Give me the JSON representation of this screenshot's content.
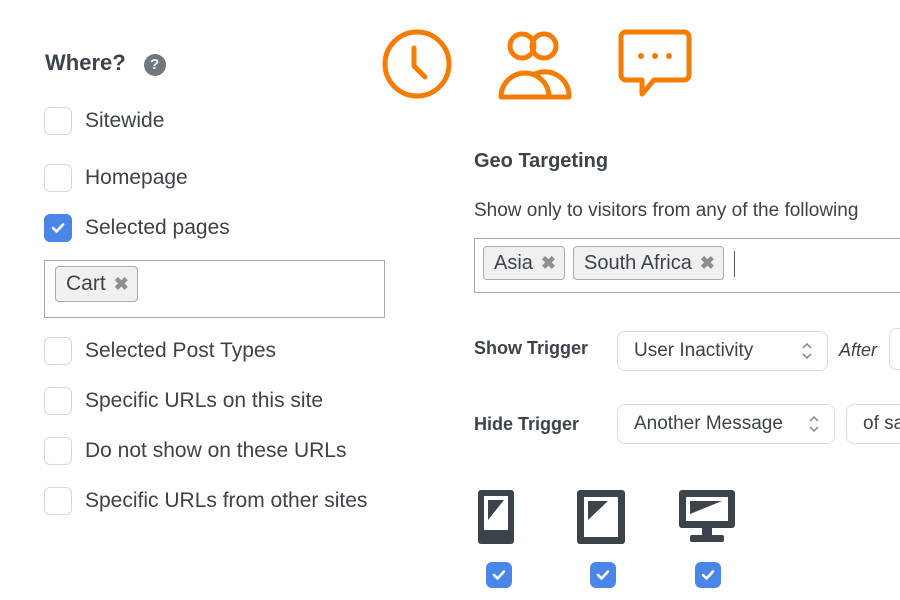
{
  "where": {
    "title": "Where?",
    "help_icon": "?",
    "options": [
      {
        "label": "Sitewide",
        "checked": false
      },
      {
        "label": "Homepage",
        "checked": false
      },
      {
        "label": "Selected pages",
        "checked": true
      },
      {
        "label": "Selected Post Types",
        "checked": false
      },
      {
        "label": "Specific URLs on this site",
        "checked": false
      },
      {
        "label": "Do not show on these URLs",
        "checked": false
      },
      {
        "label": "Specific URLs from other sites",
        "checked": false
      }
    ],
    "selected_pages_tags": [
      "Cart"
    ],
    "tag_remove_glyph": "✖"
  },
  "top_icons": [
    "clock-icon",
    "users-icon",
    "chat-bubble-icon"
  ],
  "accent_color": "#f57c00",
  "checkbox_color": "#4a86e8",
  "geo": {
    "title": "Geo Targeting",
    "description": "Show only to visitors from any of the following",
    "tags": [
      "Asia",
      "South Africa"
    ]
  },
  "triggers": {
    "show_label": "Show Trigger",
    "show_value": "User Inactivity",
    "after_label": "After",
    "hide_label": "Hide Trigger",
    "hide_value": "Another Message",
    "hide_extra_value": "of same"
  },
  "devices": [
    {
      "name": "mobile",
      "checked": true
    },
    {
      "name": "tablet",
      "checked": true
    },
    {
      "name": "desktop",
      "checked": true
    }
  ]
}
